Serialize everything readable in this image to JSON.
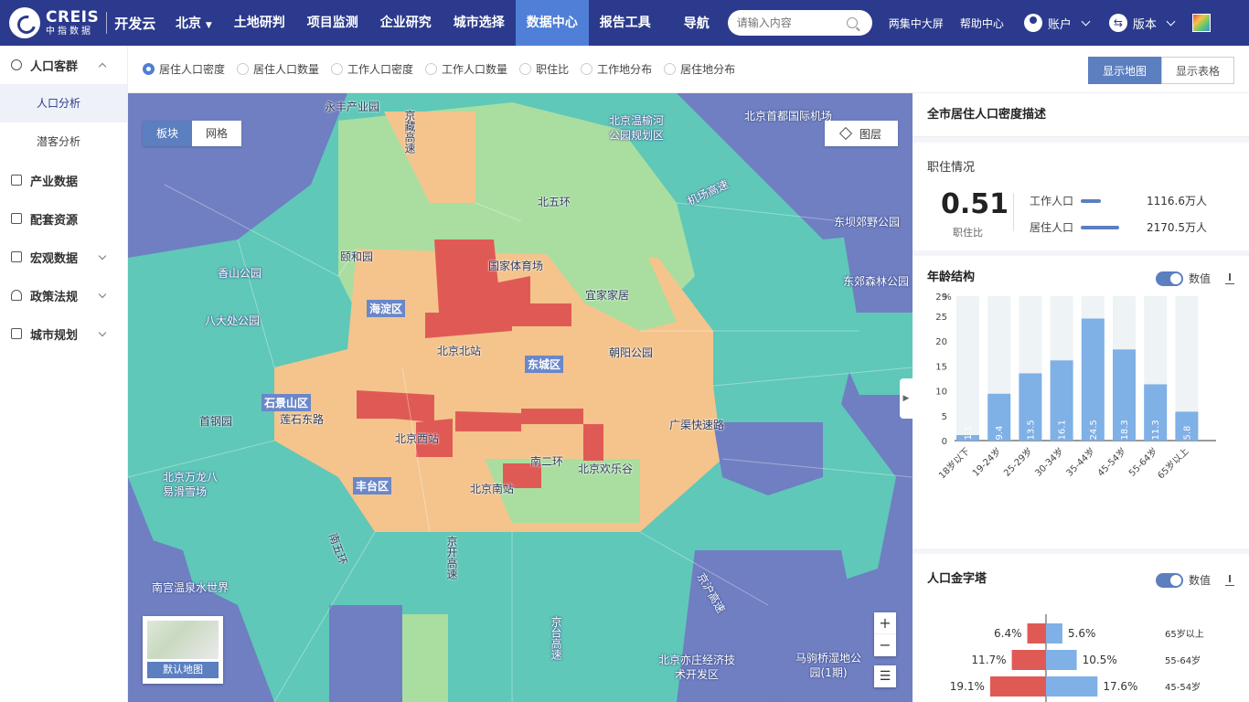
{
  "brand": {
    "logo_main": "CREIS",
    "logo_sub": "中指数据",
    "app": "开发云"
  },
  "topnav": {
    "city": "北京",
    "items": [
      "土地研判",
      "项目监测",
      "企业研究",
      "城市选择",
      "数据中心",
      "报告工具"
    ],
    "active": "数据中心",
    "guide": "导航",
    "search_placeholder": "请输入内容",
    "links": [
      "两集中大屏",
      "帮助中心"
    ],
    "account": "账户",
    "version": "版本"
  },
  "sidebar": {
    "items": [
      {
        "label": "人口客群",
        "expanded": true,
        "subs": [
          "人口分析",
          "潜客分析"
        ],
        "active_sub": "人口分析"
      },
      {
        "label": "产业数据"
      },
      {
        "label": "配套资源"
      },
      {
        "label": "宏观数据",
        "chevron": true
      },
      {
        "label": "政策法规",
        "chevron": true
      },
      {
        "label": "城市规划",
        "chevron": true
      }
    ]
  },
  "filters": {
    "options": [
      "居住人口密度",
      "居住人口数量",
      "工作人口密度",
      "工作人口数量",
      "职住比",
      "工作地分布",
      "居住地分布"
    ],
    "selected": "居住人口密度"
  },
  "view": {
    "map_label": "显示地图",
    "table_label": "显示表格",
    "active": "显示地图"
  },
  "map": {
    "seg": [
      "板块",
      "网格"
    ],
    "seg_active": "板块",
    "layer": "图层",
    "minimap_label": "默认地图",
    "zoom_in": "+",
    "zoom_out": "−",
    "labels": [
      "永丰产业园",
      "京藏高速",
      "北京温榆河公园规划区",
      "北京首都国际机场",
      "北五环",
      "机场高速",
      "东坝郊野公园",
      "香山公园",
      "颐和园",
      "国家体育场",
      "宜家家居",
      "东郊森林公园",
      "八大处公园",
      "海淀区",
      "北京北站",
      "东城区",
      "朝阳公园",
      "石景山区",
      "首钢园",
      "莲石东路",
      "北京西站",
      "广渠快速路",
      "北京万龙八易滑雪场",
      "丰台区",
      "北京南站",
      "南二环",
      "北京欢乐谷",
      "京开高速",
      "南五环",
      "南宫温泉水世界",
      "北京亦庄经济技术开发区",
      "马驹桥湿地公园(1期)",
      "京沪高速",
      "京台高速"
    ]
  },
  "panel": {
    "desc_title": "全市居住人口密度描述",
    "jz": {
      "title": "职住情况",
      "ratio": "0.51",
      "ratio_label": "职住比",
      "work_label": "工作人口",
      "work_value": "1116.6万人",
      "live_label": "居住人口",
      "live_value": "2170.5万人"
    },
    "age": {
      "title": "年龄结构",
      "toggle": "数值"
    },
    "pyramid": {
      "title": "人口金字塔",
      "toggle": "数值"
    }
  },
  "chart_data": [
    {
      "type": "bar",
      "title": "年龄结构",
      "ylabel": "%",
      "ylim": [
        0,
        29
      ],
      "yticks": [
        0,
        5,
        10,
        15,
        20,
        25,
        29
      ],
      "categories": [
        "18岁以下",
        "19-24岁",
        "25-29岁",
        "30-34岁",
        "35-44岁",
        "45-54岁",
        "55-64岁",
        "65岁以上"
      ],
      "values": [
        1.1,
        9.4,
        13.5,
        16.1,
        24.5,
        18.3,
        11.3,
        5.8
      ],
      "labels": [
        "1.1",
        "9.4",
        "13.5",
        "16.1",
        "24.5",
        "18.3",
        "11.3",
        "5.8"
      ]
    },
    {
      "type": "bar",
      "title": "人口金字塔",
      "categories": [
        "65岁以上",
        "55-64岁",
        "45-54岁"
      ],
      "series": [
        {
          "values": [
            6.4,
            11.7,
            19.1
          ],
          "labels": [
            "6.4%",
            "11.7%",
            "19.1%"
          ]
        },
        {
          "values": [
            5.6,
            10.5,
            17.6
          ],
          "labels": [
            "5.6%",
            "10.5%",
            "17.6%"
          ]
        }
      ]
    }
  ],
  "colors": {
    "nav_bg": "#2b3a8c",
    "accent": "#4f7fd6",
    "red": "#e05a55",
    "orange": "#f4c48c",
    "lgreen": "#a9dea0",
    "teal": "#5fc8b8",
    "blue": "#6f7fc2",
    "bar": "#7fb0e6",
    "bar_bg": "#eef3f6"
  }
}
